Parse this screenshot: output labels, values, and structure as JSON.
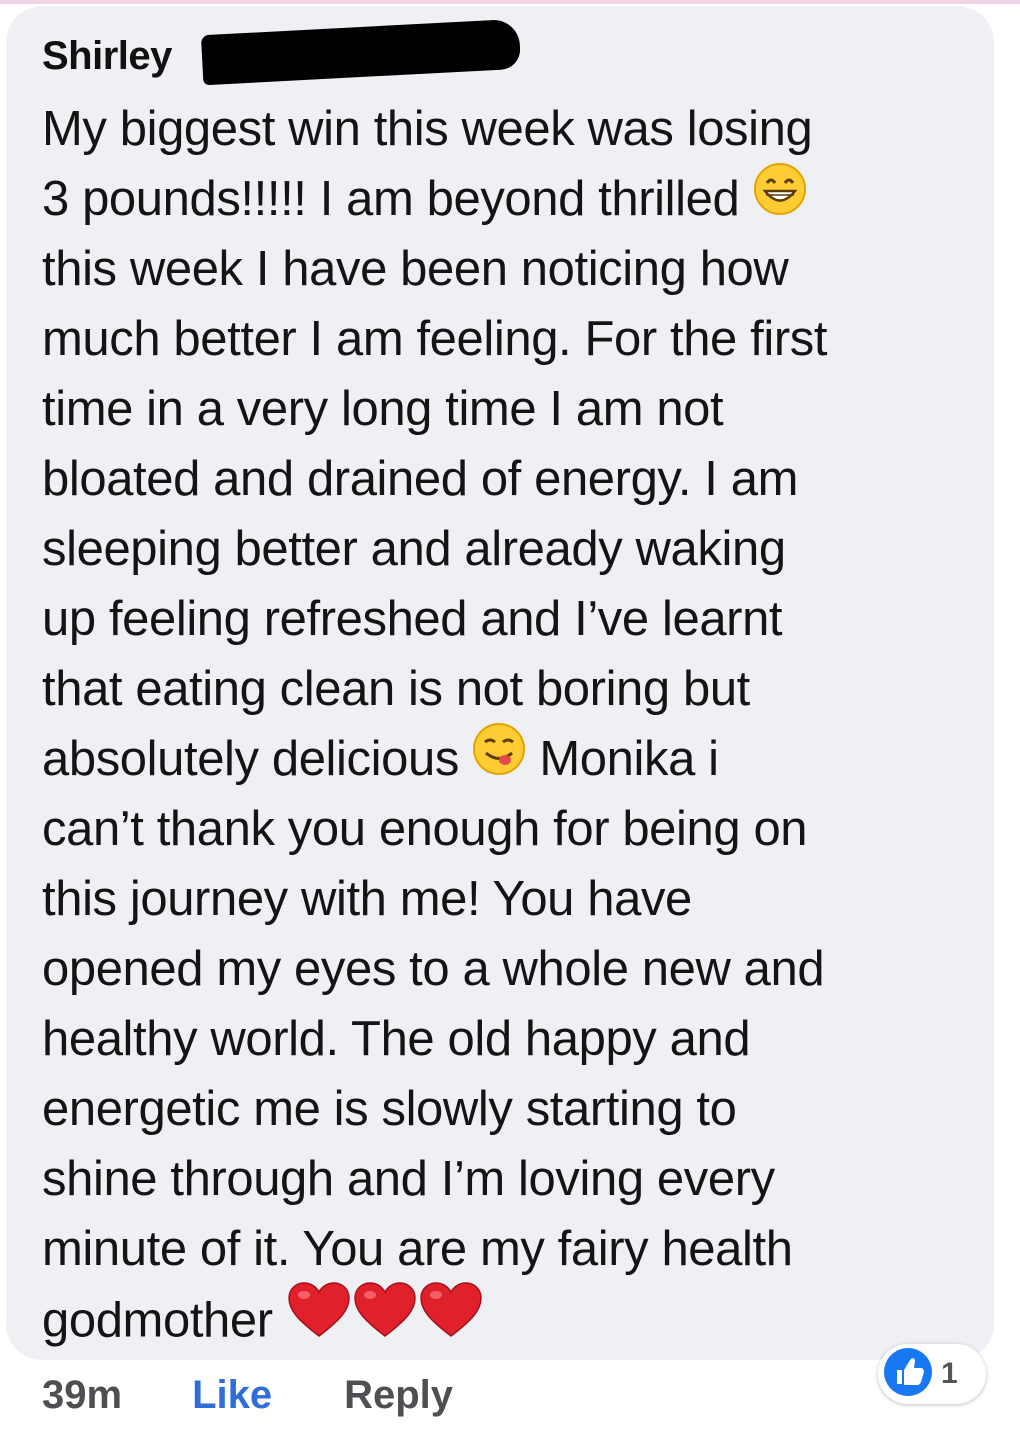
{
  "comment": {
    "author": "Shirley",
    "lines": [
      "My biggest win this week was losing",
      "3 pounds!!!!! I am beyond thrilled",
      "this week I have been noticing how",
      "much better I am feeling. For the first",
      "time in a very long time I am not",
      "bloated and drained of energy. I am",
      "sleeping better and already waking",
      "up feeling refreshed and I’ve learnt",
      "that eating clean is not boring but",
      "absolutely delicious",
      "Monika i",
      "can’t thank you enough for being on",
      "this journey with me! You have",
      "opened my eyes to a whole new and",
      "healthy world. The old happy and",
      "energetic me is slowly starting to",
      "shine through and I’m loving every",
      "minute of it. You are my fairy health",
      "godmother"
    ],
    "emojis": [
      "grinning-face-emoji",
      "face-savoring-food-emoji",
      "red-heart-emoji"
    ]
  },
  "footer": {
    "timestamp": "39m",
    "like_label": "Like",
    "reply_label": "Reply"
  },
  "reactions": {
    "icon": "thumbs-up-icon",
    "count": "1",
    "color": "#1877f2"
  },
  "colors": {
    "bubble": "#eef0f4",
    "like_link": "#2f6ed7"
  }
}
